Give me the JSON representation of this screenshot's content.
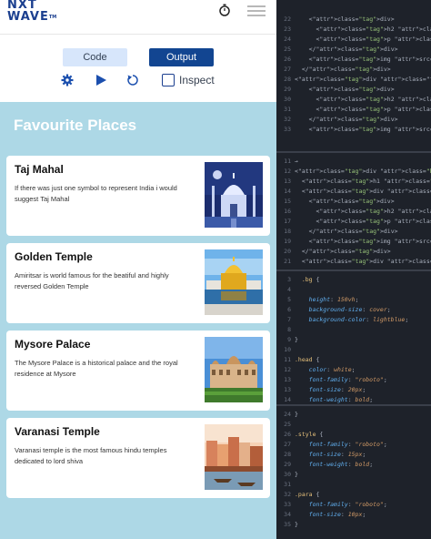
{
  "header": {
    "logo_line1": "NXT",
    "logo_line2": "WAVE",
    "logo_tm": "TM",
    "timer_icon": "timer-icon",
    "menu_icon": "hamburger-menu-icon"
  },
  "toolbar": {
    "code_label": "Code",
    "output_label": "Output",
    "inspect_label": "Inspect",
    "icons": [
      "settings-gear-icon",
      "run-play-icon",
      "reset-icon"
    ],
    "colors": {
      "code_bg": "#d7e6fb",
      "output_bg": "#124591"
    }
  },
  "preview": {
    "title": "Favourite Places",
    "background": "#add8e6",
    "cards": [
      {
        "title": "Taj Mahal",
        "para": "If there was just one symbol to represent India i would suggest Taj Mahal",
        "image": "taj-mahal-image"
      },
      {
        "title": "Golden Temple",
        "para": "Amiritsar is world famous for the beatiful and highly reversed Golden Temple",
        "image": "golden-temple-image"
      },
      {
        "title": "Mysore Palace",
        "para": "The Mysore Palace is a historical palace and the royal residence at Mysore",
        "image": "mysore-palace-image"
      },
      {
        "title": "Varanasi Temple",
        "para": "Varanasi temple is the most famous hindu temples dedicated to lord shiva",
        "image": "varanasi-temple-image"
      }
    ]
  },
  "editor": {
    "html_top": [
      {
        "n": "22",
        "code": "    <div>"
      },
      {
        "n": "23",
        "code": "      <h2 class=\"style\"> Golden Templ"
      },
      {
        "n": "24",
        "code": "      <p class=\"para\"> Amiritsar is w"
      },
      {
        "n": "25",
        "code": "    </div>"
      },
      {
        "n": "26",
        "code": "    <img src=\"https://t3.ftcdn.net/jp"
      },
      {
        "n": "27",
        "code": "  </div>"
      },
      {
        "n": "28",
        "code": "<div class=\"t-card d-flex flex-row jus"
      },
      {
        "n": "29",
        "code": "    <div>"
      },
      {
        "n": "30",
        "code": "      <h2 class=\"style\">Mysore Palace"
      },
      {
        "n": "31",
        "code": "      <p class=\"para\"> The Mysore Pal"
      },
      {
        "n": "32",
        "code": "    </div>"
      },
      {
        "n": "33",
        "code": "    <img src=\"https://t4.ftcdn.net/jp"
      }
    ],
    "html_bottom": [
      {
        "n": "11",
        "code": "→"
      },
      {
        "n": "12",
        "code": "<div class=\"bg\">"
      },
      {
        "n": "13",
        "code": "  <h1 class=\"head\">Favourite Places</"
      },
      {
        "n": "14",
        "code": "  <div class=\"t-card d-flex flex-row j"
      },
      {
        "n": "15",
        "code": "    <div>"
      },
      {
        "n": "16",
        "code": "      <h2 class=\"style\"> Taj Mahal"
      },
      {
        "n": "17",
        "code": "      <p class=\"para\"> If there wa"
      },
      {
        "n": "18",
        "code": "    </div>"
      },
      {
        "n": "19",
        "code": "    <img src=\"https://as1.ftcdn.net/"
      },
      {
        "n": "20",
        "code": "  </div>"
      },
      {
        "n": "21",
        "code": "  <div class=\"t-card d-flex flex-row j"
      }
    ],
    "css_mid": [
      {
        "n": "3",
        "code": "  .bg {"
      },
      {
        "n": "4",
        "code": ""
      },
      {
        "n": "5",
        "code": "    height: 150vh;"
      },
      {
        "n": "6",
        "code": "    background-size: cover;"
      },
      {
        "n": "7",
        "code": "    background-color: lightblue;"
      },
      {
        "n": "8",
        "code": ""
      },
      {
        "n": "9",
        "code": "}"
      },
      {
        "n": "10",
        "code": ""
      },
      {
        "n": "11",
        "code": ".head {"
      },
      {
        "n": "12",
        "code": "    color: white;"
      },
      {
        "n": "13",
        "code": "    font-family: \"roboto\";"
      },
      {
        "n": "13",
        "code": "    font-size: 20px;"
      },
      {
        "n": "14",
        "code": "    font-weight: bold;"
      }
    ],
    "css_bottom": [
      {
        "n": "24",
        "code": "}"
      },
      {
        "n": "25",
        "code": ""
      },
      {
        "n": "26",
        "code": ".style {"
      },
      {
        "n": "27",
        "code": "    font-family: \"roboto\";"
      },
      {
        "n": "28",
        "code": "    font-size: 15px;"
      },
      {
        "n": "29",
        "code": "    font-weight: bold;"
      },
      {
        "n": "30",
        "code": "}"
      },
      {
        "n": "31",
        "code": ""
      },
      {
        "n": "32",
        "code": ".para {"
      },
      {
        "n": "33",
        "code": "    font-family: \"roboto\";"
      },
      {
        "n": "34",
        "code": "    font-size: 10px;"
      },
      {
        "n": "35",
        "code": "}"
      }
    ]
  }
}
